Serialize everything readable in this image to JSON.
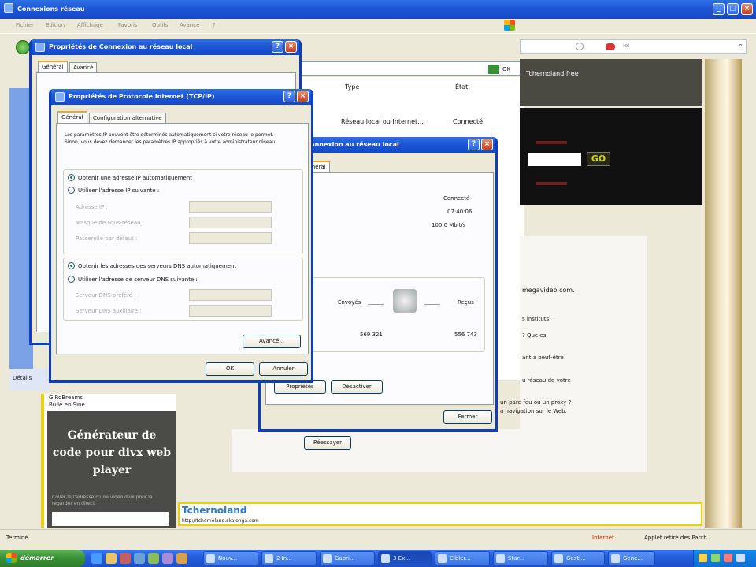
{
  "browser": {
    "title": "Connexions réseau",
    "menu": [
      "Fichier",
      "Edition",
      "Affichage",
      "Favoris",
      "Outils",
      "Avancé",
      "?"
    ],
    "status_left": "Terminé",
    "status_zone": "Internet",
    "status_right": "Applet retiré des Parch...",
    "search_placeholder": "iel",
    "columns": {
      "type": "Type",
      "state": "État"
    },
    "connection_row": {
      "type": "Réseau local ou Internet...",
      "state": "Connecté"
    },
    "go_label": "GO",
    "site_header": "Tchernoland.free",
    "site_texts": [
      "megavideo.com.",
      "s instituts.",
      "? Que es.",
      "ant a peut-être",
      "u réseau de votre",
      "un pare-feu ou un proxy ?",
      "a navigation sur le Web."
    ],
    "sidebar_promo": "Générateur de code pour divx web player",
    "sidebar_small": "Coller le l'adresse d'une vidéo divx pour la regarder en direct",
    "sidebar_top": [
      "GIRoBreams",
      "Bulle en Sine"
    ],
    "banner_title": "Tchernoland",
    "banner_url": "http://tchernoland.skalenga.com",
    "detail_tab": "Détails",
    "retry_button": "Réessayer"
  },
  "dialog_connection": {
    "title": "Propriétés de Connexion au réseau local",
    "tabs": [
      "Général",
      "Avancé"
    ]
  },
  "dialog_tcpip": {
    "title": "Propriétés de Protocole Internet (TCP/IP)",
    "tabs": [
      "Général",
      "Configuration alternative"
    ],
    "description": "Les paramètres IP peuvent être déterminés automatiquement si votre réseau le permet. Sinon, vous devez demander les paramètres IP appropriés à votre administrateur réseau.",
    "radio_ip_auto": "Obtenir une adresse IP automatiquement",
    "radio_ip_manual": "Utiliser l'adresse IP suivante :",
    "field_ip": "Adresse IP :",
    "field_mask": "Masque de sous-réseau :",
    "field_gateway": "Passerelle par défaut :",
    "radio_dns_auto": "Obtenir les adresses des serveurs DNS automatiquement",
    "radio_dns_manual": "Utiliser l'adresse de serveur DNS suivante :",
    "field_dns_pref": "Serveur DNS préféré :",
    "field_dns_alt": "Serveur DNS auxiliaire :",
    "advanced_button": "Avancé...",
    "ok_button": "OK",
    "cancel_button": "Annuler"
  },
  "dialog_status": {
    "title": "État de Connexion au réseau local",
    "tab": "Général",
    "status_value": "Connecté",
    "duration_value": "07:40:06",
    "speed_value": "100,0 Mbit/s",
    "sent_label": "Envoyés",
    "received_label": "Reçus",
    "sent_value": "569 321",
    "received_value": "556 743",
    "properties_button": "Propriétés",
    "disable_button": "Désactiver",
    "close_button": "Fermer"
  },
  "taskbar": {
    "start": "démarrer",
    "items": [
      "Nouv...",
      "2 In...",
      "Gabri...",
      "3 Ex...",
      "Cibler...",
      "Star...",
      "Gesti...",
      "Gene..."
    ],
    "clock": ""
  }
}
